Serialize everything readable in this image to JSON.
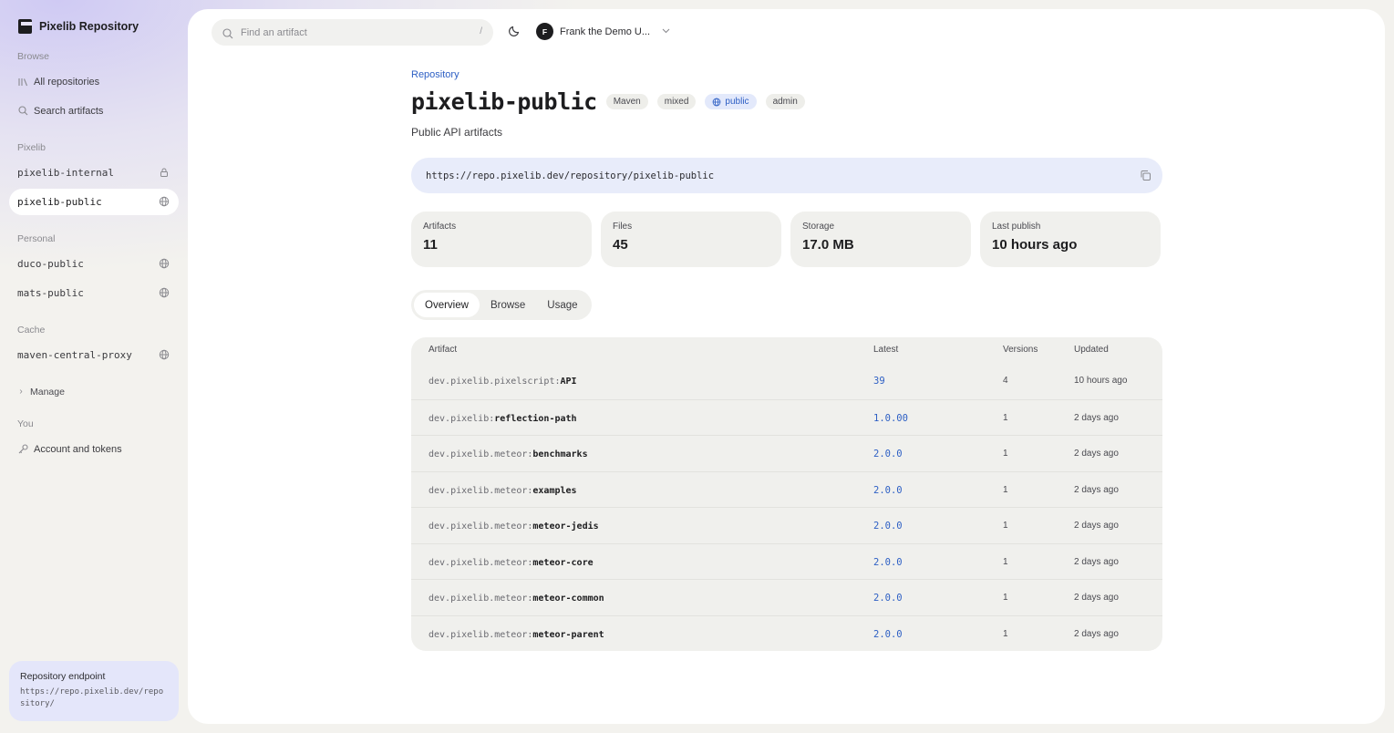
{
  "sidebar": {
    "brand": "Pixelib Repository",
    "browse_label": "Browse",
    "all_repositories": "All repositories",
    "search_artifacts": "Search artifacts",
    "pixelib_label": "Pixelib",
    "pixelib_repos": [
      {
        "name": "pixelib-internal",
        "icon": "lock-icon"
      },
      {
        "name": "pixelib-public",
        "icon": "globe-icon",
        "active": true
      }
    ],
    "personal_label": "Personal",
    "personal_repos": [
      {
        "name": "duco-public",
        "icon": "globe-icon"
      },
      {
        "name": "mats-public",
        "icon": "globe-icon"
      }
    ],
    "cache_label": "Cache",
    "cache_repos": [
      {
        "name": "maven-central-proxy",
        "icon": "globe-icon"
      }
    ],
    "manage": "Manage",
    "you_label": "You",
    "account": "Account and tokens",
    "endpoint": {
      "title": "Repository endpoint",
      "url": "https://repo.pixelib.dev/repository/"
    }
  },
  "header": {
    "search_placeholder": "Find an artifact",
    "search_shortcut": "/",
    "user_initial": "F",
    "user_name": "Frank the Demo U..."
  },
  "repo": {
    "breadcrumb": "Repository",
    "title": "pixelib-public",
    "badges": {
      "format": "Maven",
      "mode": "mixed",
      "visibility": "public",
      "role": "admin"
    },
    "description": "Public API artifacts",
    "url": "https://repo.pixelib.dev/repository/pixelib-public",
    "stats": [
      {
        "label": "Artifacts",
        "value": "11"
      },
      {
        "label": "Files",
        "value": "45"
      },
      {
        "label": "Storage",
        "value": "17.0 MB"
      },
      {
        "label": "Last publish",
        "value": "10 hours ago"
      }
    ],
    "tabs": [
      "Overview",
      "Browse",
      "Usage"
    ]
  },
  "table": {
    "headers": {
      "artifact": "Artifact",
      "latest": "Latest",
      "versions": "Versions",
      "updated": "Updated"
    },
    "rows": [
      {
        "group": "dev.pixelib.pixelscript:",
        "name": "API",
        "latest": "39",
        "versions": "4",
        "updated": "10 hours ago"
      },
      {
        "group": "dev.pixelib:",
        "name": "reflection-path",
        "latest": "1.0.00",
        "versions": "1",
        "updated": "2 days ago"
      },
      {
        "group": "dev.pixelib.meteor:",
        "name": "benchmarks",
        "latest": "2.0.0",
        "versions": "1",
        "updated": "2 days ago"
      },
      {
        "group": "dev.pixelib.meteor:",
        "name": "examples",
        "latest": "2.0.0",
        "versions": "1",
        "updated": "2 days ago"
      },
      {
        "group": "dev.pixelib.meteor:",
        "name": "meteor-jedis",
        "latest": "2.0.0",
        "versions": "1",
        "updated": "2 days ago"
      },
      {
        "group": "dev.pixelib.meteor:",
        "name": "meteor-core",
        "latest": "2.0.0",
        "versions": "1",
        "updated": "2 days ago"
      },
      {
        "group": "dev.pixelib.meteor:",
        "name": "meteor-common",
        "latest": "2.0.0",
        "versions": "1",
        "updated": "2 days ago"
      },
      {
        "group": "dev.pixelib.meteor:",
        "name": "meteor-parent",
        "latest": "2.0.0",
        "versions": "1",
        "updated": "2 days ago"
      }
    ]
  }
}
